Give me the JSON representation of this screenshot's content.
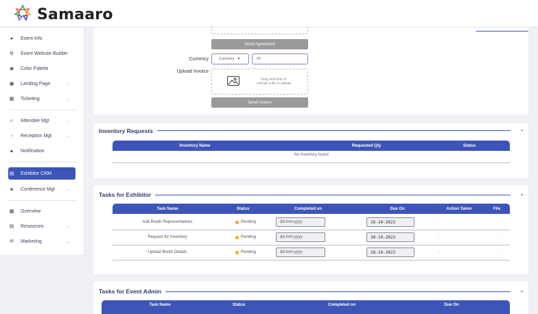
{
  "app": {
    "name": "Samaaro"
  },
  "sidebar": {
    "items": [
      {
        "label": "Event Info",
        "icon": "info-icon"
      },
      {
        "label": "Event Website Builder",
        "icon": "builder-icon"
      },
      {
        "label": "Color Palette",
        "icon": "palette-icon"
      },
      {
        "label": "Landing Page",
        "icon": "landing-page-icon"
      },
      {
        "label": "Ticketing",
        "icon": "ticket-icon"
      },
      {
        "label": "Attendee Mgt",
        "icon": "attendee-icon"
      },
      {
        "label": "Reception Mgt",
        "icon": "reception-icon"
      },
      {
        "label": "Notification",
        "icon": "bell-icon"
      },
      {
        "label": "Exhibitor CRM",
        "icon": "exhibitor-icon"
      },
      {
        "label": "Conference Mgt",
        "icon": "conference-icon"
      },
      {
        "label": "Overview",
        "icon": "overview-icon"
      },
      {
        "label": "Resources",
        "icon": "resources-icon"
      },
      {
        "label": "Marketing",
        "icon": "marketing-icon"
      }
    ],
    "active": "Exhibitor CRM"
  },
  "agreement": {
    "send_agreement_label": "Send Agreement",
    "currency_label": "Currency",
    "currency_select": "Currency",
    "amount_placeholder": "00",
    "upload_invoice_label": "Upload Invoice",
    "drop_text_1": "Drag and drop or",
    "drop_text_2": "choose a file to upload",
    "send_invoice_label": "Send Invoice"
  },
  "inventory": {
    "title": "Inventory Requests",
    "columns": [
      "Inventory Name",
      "Requested Qty",
      "Status"
    ],
    "empty_text": "No inventory found"
  },
  "tasks_exhibitor": {
    "title": "Tasks for Exhibitor",
    "columns": [
      "Task Name",
      "Status",
      "Completed on",
      "Due On",
      "Action Taken",
      "File"
    ],
    "rows": [
      {
        "task": "Add Booth Representatives",
        "status": "Pending",
        "completed": "dd-mm-yyyy",
        "due": "16-10-2023",
        "action": "-",
        "file": "-"
      },
      {
        "task": "Request for Inventory",
        "status": "Pending",
        "completed": "dd-mm-yyyy",
        "due": "30-10-2023",
        "action": "-",
        "file": "-"
      },
      {
        "task": "Upload Booth Details",
        "status": "Pending",
        "completed": "dd-mm-yyyy",
        "due": "28-10-2023",
        "action": "-",
        "file": "-"
      }
    ],
    "status_color": "#f5a623"
  },
  "tasks_admin": {
    "title": "Tasks for Event Admin",
    "columns": [
      "Task Name",
      "Status",
      "Completed on",
      "Due On"
    ]
  },
  "colors": {
    "accent": "#3d54b8",
    "button_gray": "#999999"
  }
}
